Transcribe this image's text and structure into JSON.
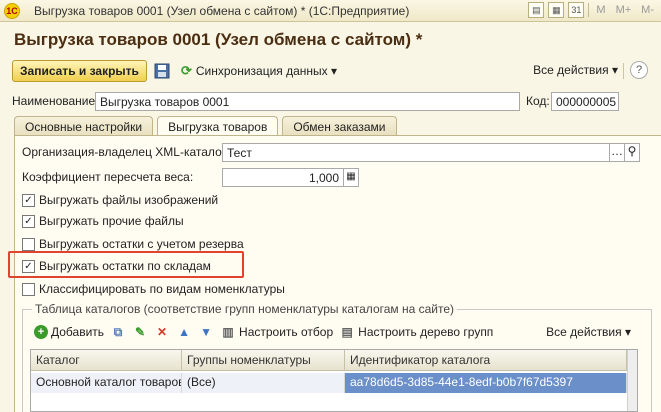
{
  "window": {
    "logo": "1C",
    "title": "Выгрузка товаров 0001 (Узел обмена с сайтом) * (1С:Предприятие)",
    "tools": [
      "M",
      "M+",
      "M-"
    ]
  },
  "form": {
    "title": "Выгрузка товаров 0001 (Узел обмена с сайтом) *"
  },
  "toolbar": {
    "save_close_label": "Записать и закрыть",
    "sync_label": "Синхронизация данных ▾",
    "all_actions_label": "Все действия ▾",
    "help_label": "?"
  },
  "header_fields": {
    "name_label": "Наименование:",
    "name_value": "Выгрузка товаров 0001",
    "code_label": "Код:",
    "code_value": "000000005"
  },
  "tabs": [
    {
      "label": "Основные настройки"
    },
    {
      "label": "Выгрузка товаров"
    },
    {
      "label": "Обмен заказами"
    }
  ],
  "export_tab": {
    "owner_label": "Организация-владелец XML-каталога:",
    "owner_value": "Тест",
    "weight_label": "Коэффициент пересчета веса:",
    "weight_value": "1,000",
    "options": [
      {
        "label": "Выгружать файлы изображений",
        "mark": "✓"
      },
      {
        "label": "Выгружать прочие файлы",
        "mark": "✓"
      },
      {
        "label": "Выгружать остатки с учетом резерва",
        "mark": ""
      },
      {
        "label": "Выгружать остатки по складам",
        "mark": "✓"
      },
      {
        "label": "Классифицировать по видам номенклатуры",
        "mark": ""
      }
    ]
  },
  "catalogs": {
    "group_title": "Таблица каталогов (соответствие групп номенклатуры каталогам на сайте)",
    "add_label": "Добавить",
    "filter_label": "Настроить отбор",
    "tree_label": "Настроить дерево групп",
    "all_actions_label": "Все действия ▾",
    "columns": [
      "Каталог",
      "Группы номенклатуры",
      "Идентификатор каталога"
    ],
    "rows": [
      [
        "Основной каталог товаров",
        "(Все)",
        "aa78d6d5-3d85-44e1-8edf-b0b7f67d5397"
      ]
    ]
  },
  "colors": {
    "accent": "#f0d04f",
    "title": "#4b2e12",
    "highlight": "#e0432e",
    "selection": "#6b8fc8"
  }
}
